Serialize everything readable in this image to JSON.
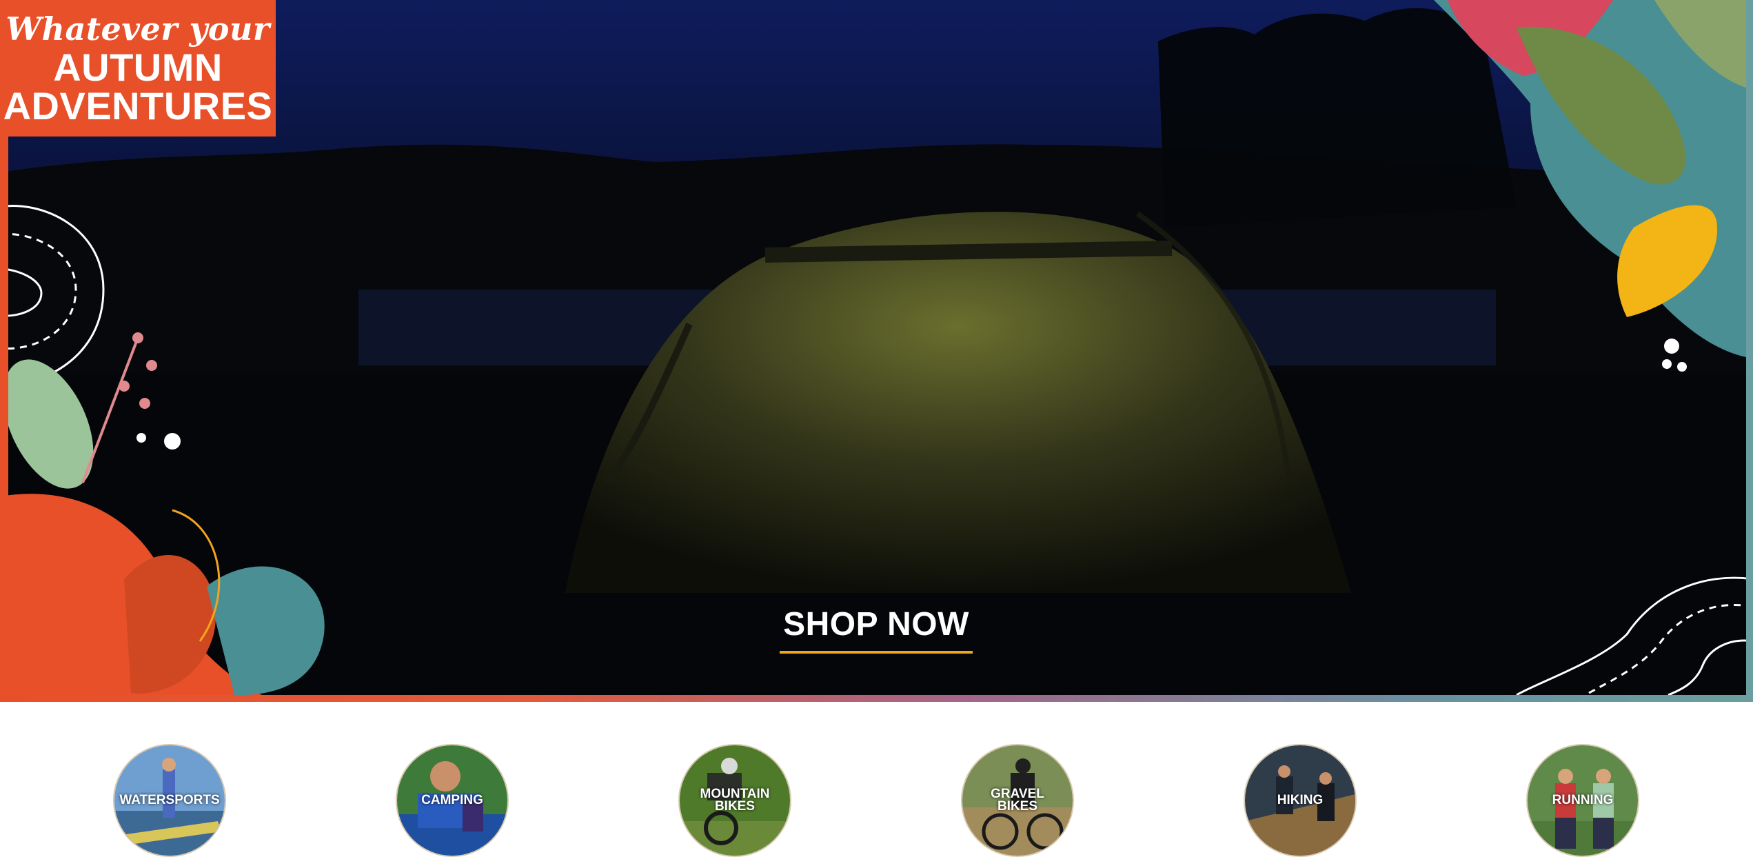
{
  "hero": {
    "badge": {
      "script_line": "Whatever your",
      "title_line1": "AUTUMN",
      "title_line2": "ADVENTURES"
    },
    "cta_label": "SHOP NOW",
    "colors": {
      "brand_orange": "#e8502a",
      "cta_underline": "#f2a51a",
      "teal": "#4a8f93",
      "night_sky": "#0c1a52"
    }
  },
  "categories": [
    {
      "label": "WATERSPORTS",
      "icon": "watersports-photo"
    },
    {
      "label": "CAMPING",
      "icon": "camping-photo"
    },
    {
      "label": "MOUNTAIN\nBIKES",
      "icon": "mountain-bike-photo"
    },
    {
      "label": "GRAVEL\nBIKES",
      "icon": "gravel-bike-photo"
    },
    {
      "label": "HIKING",
      "icon": "hiking-photo"
    },
    {
      "label": "RUNNING",
      "icon": "running-photo"
    }
  ]
}
